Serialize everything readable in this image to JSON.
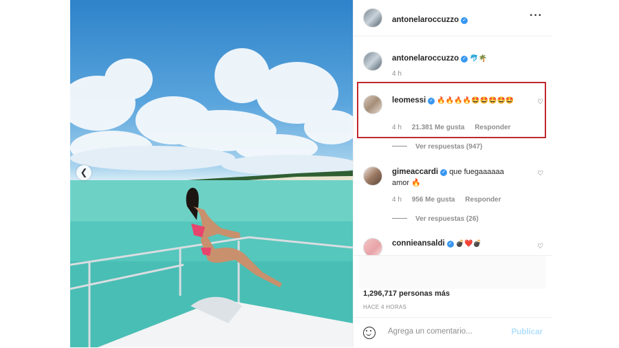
{
  "post": {
    "author": {
      "username": "antonelaroccuzzo",
      "verified": true
    },
    "caption": {
      "username": "antonelaroccuzzo",
      "emoji": "🐬🌴",
      "time": "4 h"
    },
    "comments": [
      {
        "username": "leomessi",
        "text": "🔥🔥🔥🔥🤩🤩🤩🤩🤩",
        "time": "4 h",
        "likes": "21.381 Me gusta",
        "reply_label": "Responder",
        "view_replies": "Ver respuestas (947)",
        "highlighted": true
      },
      {
        "username": "gimeaccardi",
        "text": "que fuegaaaaaa amor 🔥",
        "time": "4 h",
        "likes": "956 Me gusta",
        "reply_label": "Responder",
        "view_replies": "Ver respuestas (26)"
      },
      {
        "username": "connieansaldi",
        "text": "💣❤️💣"
      }
    ],
    "likes": {
      "prefix": "1,296,717",
      "suffix": "personas más"
    },
    "posted_ago": "HACE 4 HORAS",
    "comment_input": {
      "placeholder": "Agrega un comentario...",
      "publish_label": "Publicar"
    }
  },
  "icons": {
    "verified": "verified-badge-icon",
    "more": "more-options-icon",
    "heart": "heart-outline-icon",
    "emoji": "emoji-smile-icon",
    "prev": "chevron-left-icon"
  },
  "colors": {
    "accent": "#3897f0",
    "highlight": "#c0272d",
    "muted": "#8e8e8e",
    "publish_disabled": "#b2dffc"
  }
}
